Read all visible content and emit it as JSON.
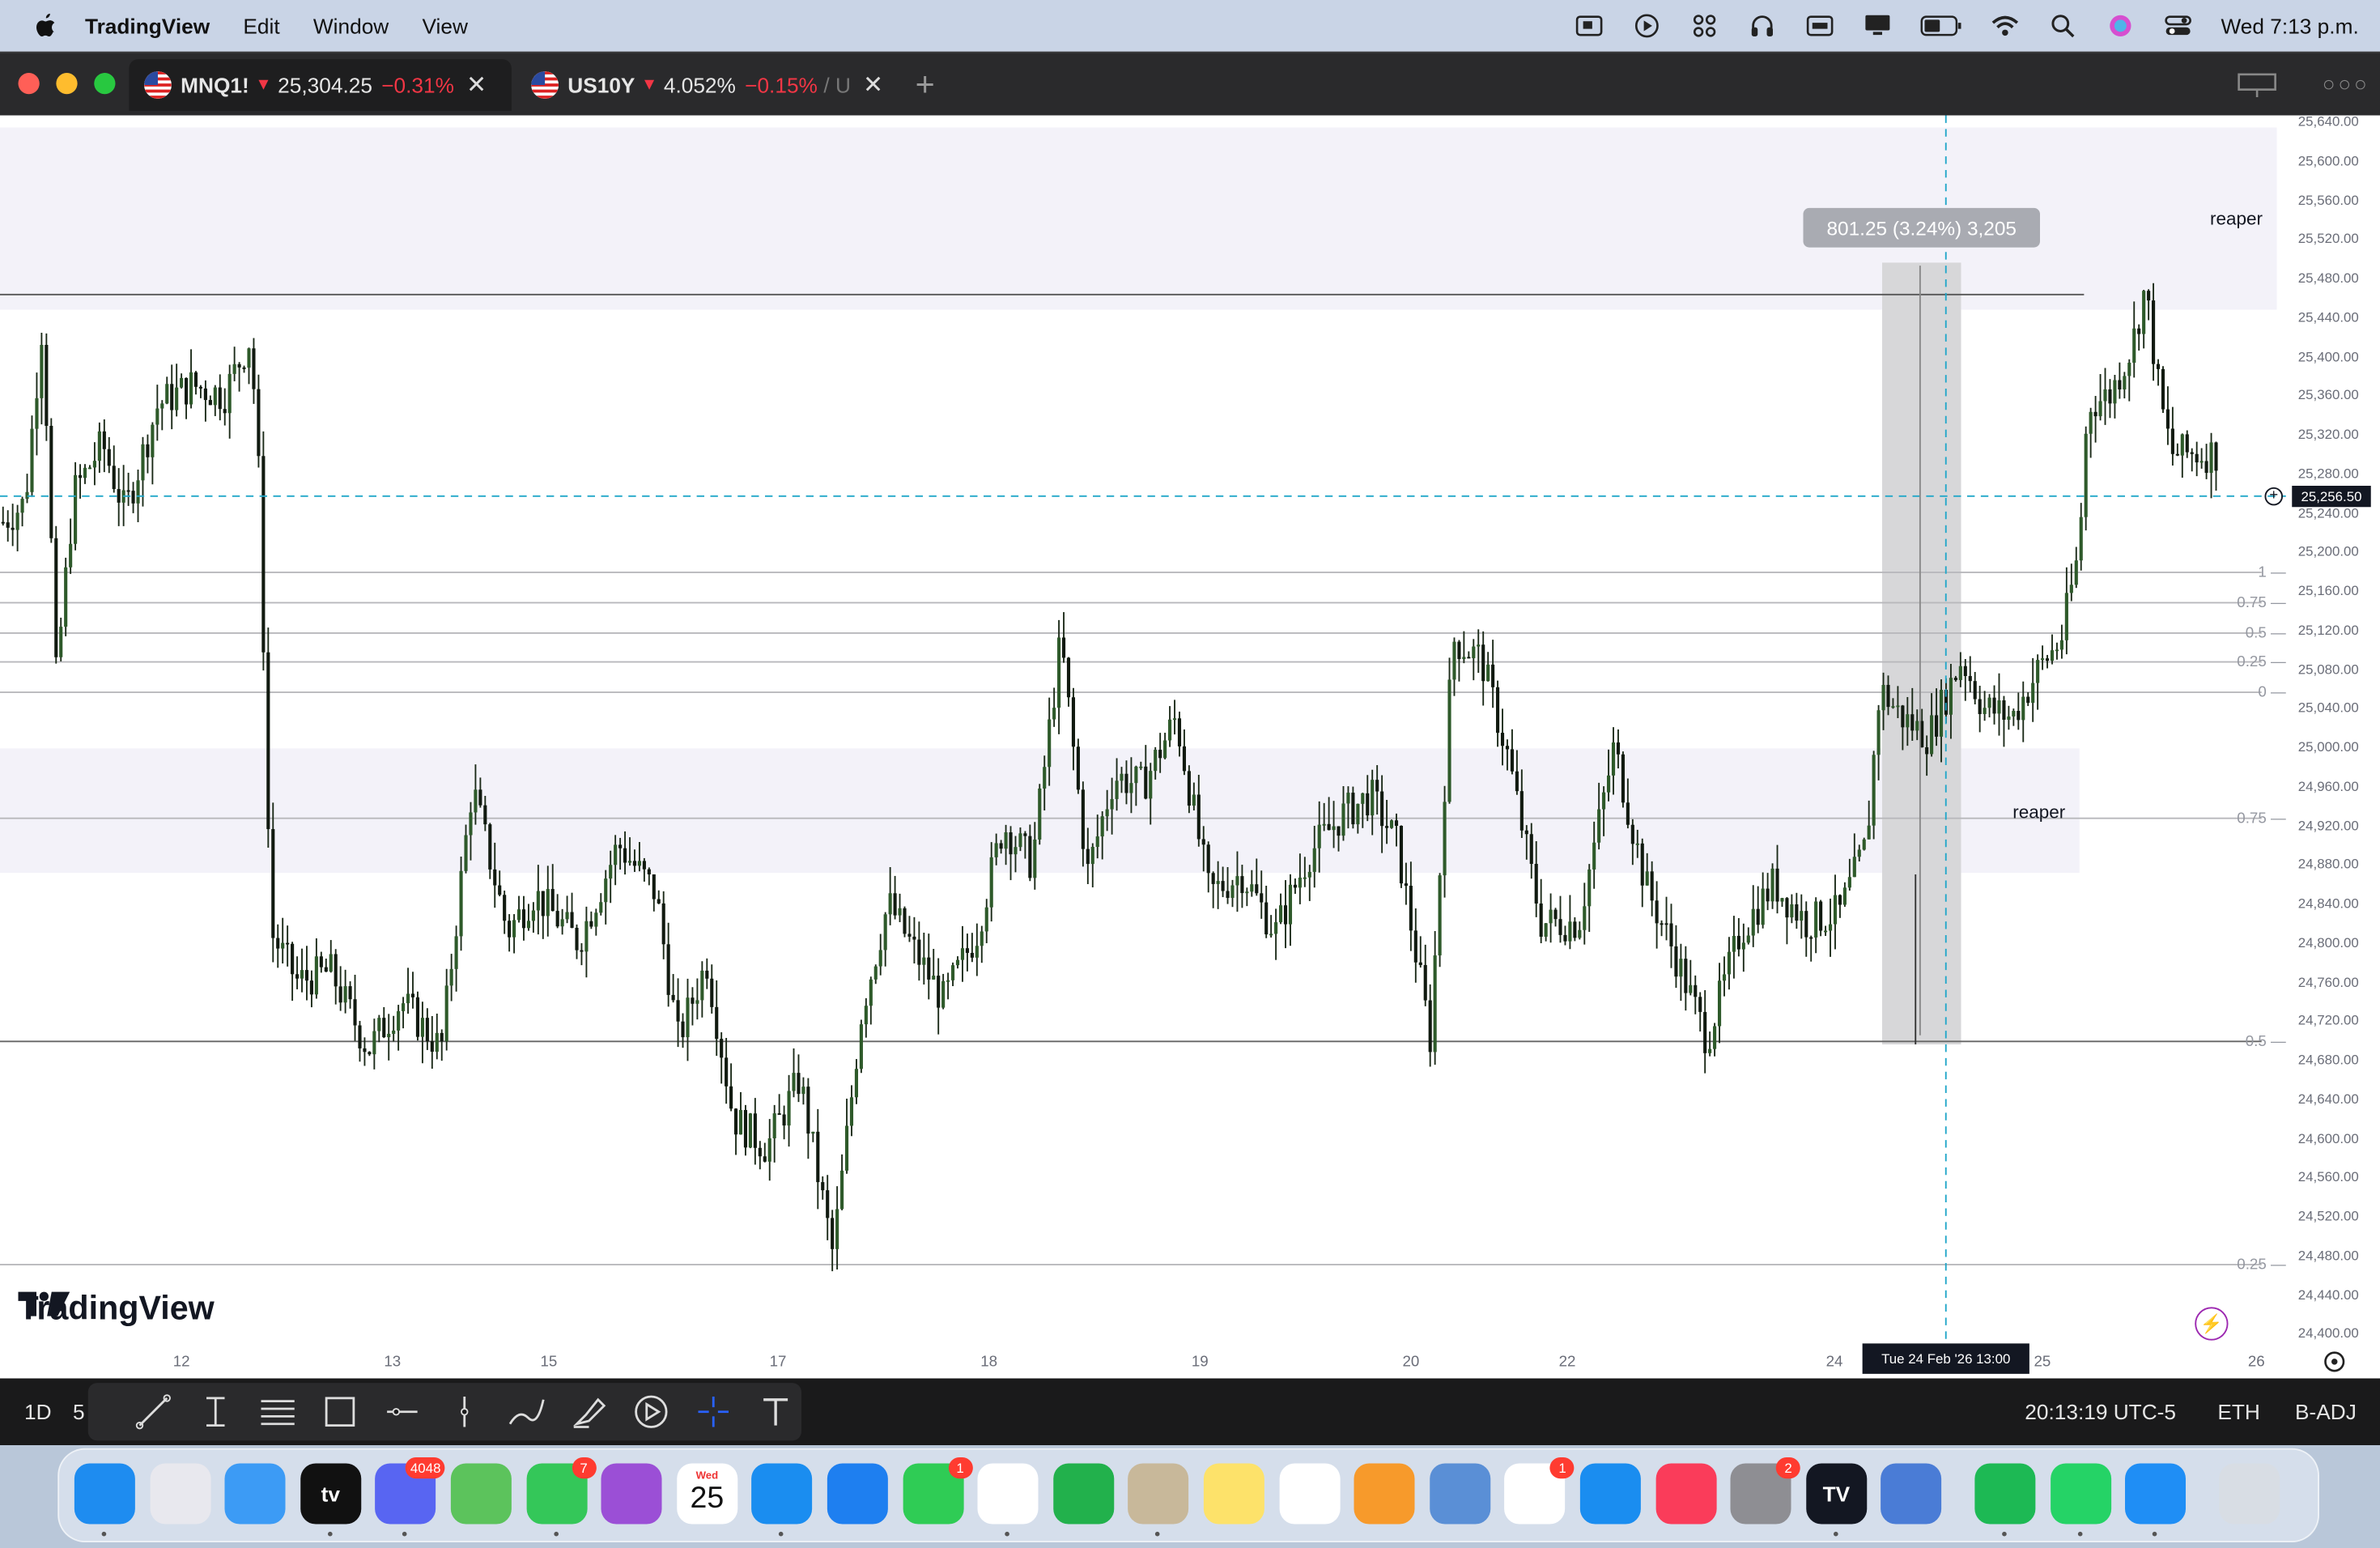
{
  "menubar": {
    "app_name": "TradingView",
    "menus": [
      "Edit",
      "Window",
      "View"
    ],
    "clock": "Wed 7:13 p.m.",
    "status_icons": [
      "screen-capture-icon",
      "play-icon",
      "apps-grid-icon",
      "headphones-icon",
      "keyboard-icon",
      "display-icon",
      "battery-icon",
      "wifi-icon",
      "spotlight-search-icon",
      "siri-icon",
      "control-center-icon"
    ]
  },
  "tabs": [
    {
      "symbol": "MNQ1!",
      "price": "25,304.25",
      "change": "−0.31%",
      "active": true
    },
    {
      "symbol": "US10Y",
      "price": "4.052%",
      "change": "−0.15%",
      "suffix": "/ U",
      "active": false
    }
  ],
  "new_tab_symbol": "+",
  "chart": {
    "watermark": "TradingView",
    "measure_label": "801.25 (3.24%) 3,205",
    "current_price_label": "25,256.50",
    "crosshair_time": "Tue 24 Feb '26   13:00",
    "annotations": [
      "reaper",
      "reaper"
    ],
    "price_axis": [
      "25,640.00",
      "25,600.00",
      "25,560.00",
      "25,520.00",
      "25,480.00",
      "25,440.00",
      "25,400.00",
      "25,360.00",
      "25,320.00",
      "25,280.00",
      "25,240.00",
      "25,200.00",
      "25,160.00",
      "25,120.00",
      "25,080.00",
      "25,040.00",
      "25,000.00",
      "24,960.00",
      "24,920.00",
      "24,880.00",
      "24,840.00",
      "24,800.00",
      "24,760.00",
      "24,720.00",
      "24,680.00",
      "24,640.00",
      "24,600.00",
      "24,560.00",
      "24,520.00",
      "24,480.00",
      "24,440.00",
      "24,400.00"
    ],
    "time_axis": [
      "12",
      "13",
      "15",
      "17",
      "18",
      "19",
      "20",
      "22",
      "24",
      "25",
      "26"
    ],
    "fib_levels": [
      "1",
      "0.75",
      "0.5",
      "0.25",
      "0",
      "0.75",
      "0.5",
      "0.25"
    ]
  },
  "chart_data": {
    "type": "candlestick",
    "instrument": "MNQ1!",
    "y_range": [
      24380,
      25650
    ],
    "x_ticks": [
      "12",
      "13",
      "15",
      "17",
      "18",
      "19",
      "20",
      "22",
      "24",
      "25",
      "26"
    ],
    "current_price": 25256.5,
    "path_points": [
      [
        0,
        25230
      ],
      [
        0.01,
        25250
      ],
      [
        0.018,
        25440
      ],
      [
        0.024,
        25070
      ],
      [
        0.032,
        25260
      ],
      [
        0.045,
        25310
      ],
      [
        0.055,
        25240
      ],
      [
        0.07,
        25350
      ],
      [
        0.085,
        25370
      ],
      [
        0.1,
        25360
      ],
      [
        0.112,
        25420
      ],
      [
        0.116,
        25260
      ],
      [
        0.121,
        24810
      ],
      [
        0.133,
        24760
      ],
      [
        0.148,
        24770
      ],
      [
        0.165,
        24690
      ],
      [
        0.18,
        24740
      ],
      [
        0.198,
        24690
      ],
      [
        0.212,
        24960
      ],
      [
        0.228,
        24810
      ],
      [
        0.24,
        24850
      ],
      [
        0.26,
        24800
      ],
      [
        0.278,
        24900
      ],
      [
        0.295,
        24850
      ],
      [
        0.305,
        24700
      ],
      [
        0.318,
        24780
      ],
      [
        0.33,
        24620
      ],
      [
        0.345,
        24590
      ],
      [
        0.36,
        24660
      ],
      [
        0.375,
        24480
      ],
      [
        0.388,
        24730
      ],
      [
        0.4,
        24840
      ],
      [
        0.412,
        24790
      ],
      [
        0.425,
        24740
      ],
      [
        0.44,
        24810
      ],
      [
        0.452,
        24920
      ],
      [
        0.465,
        24880
      ],
      [
        0.478,
        25110
      ],
      [
        0.49,
        24870
      ],
      [
        0.502,
        24970
      ],
      [
        0.515,
        24960
      ],
      [
        0.53,
        25030
      ],
      [
        0.545,
        24850
      ],
      [
        0.56,
        24870
      ],
      [
        0.575,
        24810
      ],
      [
        0.59,
        24890
      ],
      [
        0.605,
        24930
      ],
      [
        0.618,
        24950
      ],
      [
        0.63,
        24900
      ],
      [
        0.645,
        24700
      ],
      [
        0.655,
        25110
      ],
      [
        0.668,
        25090
      ],
      [
        0.68,
        24990
      ],
      [
        0.695,
        24820
      ],
      [
        0.712,
        24820
      ],
      [
        0.728,
        25000
      ],
      [
        0.742,
        24860
      ],
      [
        0.755,
        24790
      ],
      [
        0.77,
        24700
      ],
      [
        0.785,
        24810
      ],
      [
        0.8,
        24860
      ],
      [
        0.815,
        24820
      ],
      [
        0.83,
        24830
      ],
      [
        0.842,
        24900
      ],
      [
        0.848,
        25060
      ],
      [
        0.858,
        25030
      ],
      [
        0.87,
        25010
      ],
      [
        0.885,
        25090
      ],
      [
        0.895,
        25040
      ],
      [
        0.908,
        25030
      ],
      [
        0.92,
        25080
      ],
      [
        0.93,
        25110
      ],
      [
        0.938,
        25200
      ],
      [
        0.942,
        25350
      ],
      [
        0.952,
        25360
      ],
      [
        0.962,
        25410
      ],
      [
        0.968,
        25470
      ],
      [
        0.975,
        25350
      ],
      [
        0.98,
        25300
      ]
    ]
  },
  "toolbar": {
    "interval": "1D",
    "interval2": "5",
    "time": "20:13:19 UTC-5",
    "session": "ETH",
    "adjust": "B-ADJ"
  },
  "dock": {
    "apps": [
      {
        "name": "finder",
        "label": "",
        "color": "#1e8cf0"
      },
      {
        "name": "launchpad",
        "label": "",
        "color": "#e8e8ee"
      },
      {
        "name": "mail",
        "label": "",
        "color": "#3c9bf5"
      },
      {
        "name": "apple-tv",
        "label": "tv",
        "color": "#111111"
      },
      {
        "name": "discord",
        "label": "",
        "color": "#5865f2",
        "badge": "4048"
      },
      {
        "name": "maps",
        "label": "",
        "color": "#5cc35c"
      },
      {
        "name": "messages",
        "label": "",
        "color": "#34c759",
        "badge": "7"
      },
      {
        "name": "podcasts",
        "label": "",
        "color": "#9b4fd6"
      },
      {
        "name": "calendar",
        "label": "25",
        "sub": "Wed",
        "color": "#ffffff"
      },
      {
        "name": "safari",
        "label": "",
        "color": "#1a8df0"
      },
      {
        "name": "keynote",
        "label": "",
        "color": "#1e7ff0"
      },
      {
        "name": "facetime",
        "label": "",
        "color": "#2fcc55",
        "badge": "1"
      },
      {
        "name": "opera",
        "label": "",
        "color": "#ffffff"
      },
      {
        "name": "numbers",
        "label": "",
        "color": "#22b14c"
      },
      {
        "name": "contacts",
        "label": "",
        "color": "#c8b89a"
      },
      {
        "name": "notes",
        "label": "",
        "color": "#fde26a"
      },
      {
        "name": "photos",
        "label": "",
        "color": "#ffffff"
      },
      {
        "name": "pages",
        "label": "",
        "color": "#f79a2b"
      },
      {
        "name": "preview",
        "label": "",
        "color": "#5a8fd6"
      },
      {
        "name": "reminders",
        "label": "",
        "color": "#ffffff",
        "badge": "1"
      },
      {
        "name": "app-store",
        "label": "",
        "color": "#1a8df0"
      },
      {
        "name": "music",
        "label": "",
        "color": "#fa3c5a"
      },
      {
        "name": "system-settings",
        "label": "",
        "color": "#8e8e93",
        "badge": "2"
      },
      {
        "name": "tradingview",
        "label": "TV",
        "color": "#131722"
      },
      {
        "name": "simulator",
        "label": "",
        "color": "#4a7cd6"
      },
      {
        "name": "spotify",
        "label": "",
        "color": "#1db954"
      },
      {
        "name": "whatsapp",
        "label": "",
        "color": "#25d366"
      },
      {
        "name": "quicktime",
        "label": "",
        "color": "#1f8ef5"
      },
      {
        "name": "trash",
        "label": "",
        "color": "#d8dde4"
      }
    ]
  },
  "colors": {
    "accent_red": "#f23645",
    "crosshair": "#22a7c9",
    "candle": "#1f3d1c",
    "zone": "#f3f2f9"
  }
}
